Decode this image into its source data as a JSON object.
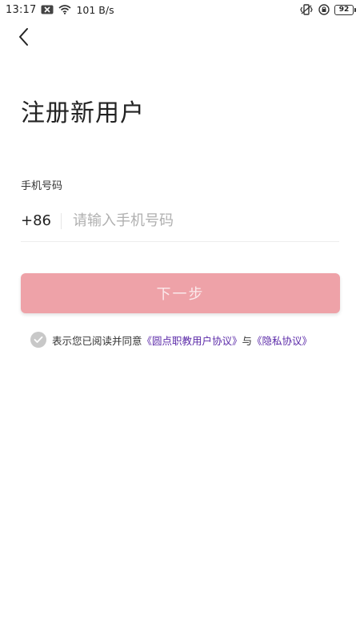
{
  "status_bar": {
    "time": "13:17",
    "network_speed": "101 B/s",
    "battery": "92",
    "icons": [
      "notification-off-icon",
      "wifi-icon",
      "vibrate-icon",
      "rotation-lock-icon",
      "battery-icon"
    ]
  },
  "header": {
    "back_icon": "chevron-left-icon"
  },
  "title": "注册新用户",
  "phone": {
    "label": "手机号码",
    "country_code": "+86",
    "value": "",
    "placeholder": "请输入手机号码"
  },
  "next_button": {
    "label": "下一步",
    "enabled": false
  },
  "agreement": {
    "checked": false,
    "prefix": "表示您已阅读并同意",
    "user_agreement": "《圆点职教用户协议》",
    "conjunction": "与",
    "privacy_policy": "《隐私协议》"
  },
  "colors": {
    "button_bg": "#eea2a8",
    "link": "#5b2aa8",
    "check_bg": "#c8c8c8"
  }
}
